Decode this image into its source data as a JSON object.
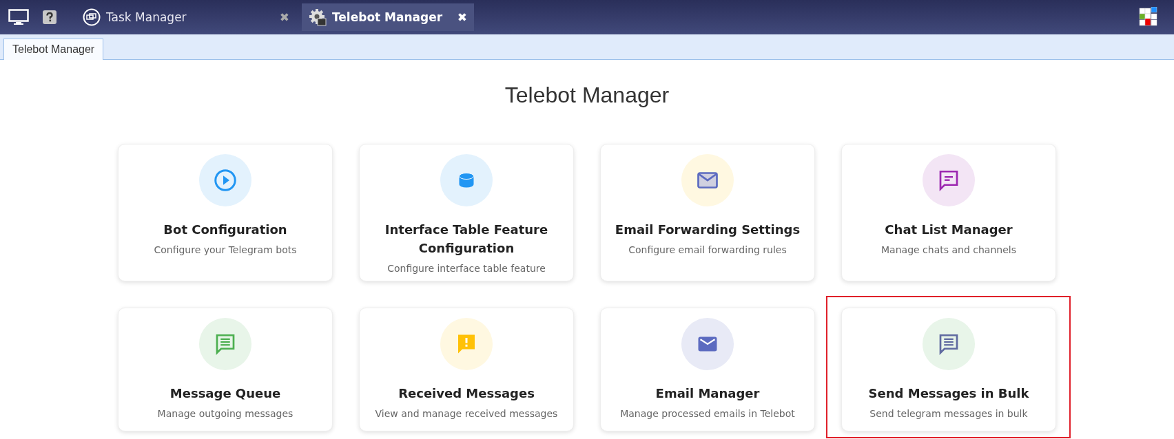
{
  "window_tabs": [
    {
      "kind": "task",
      "label": "Task Manager",
      "close": "✖",
      "selected": false
    },
    {
      "kind": "gear",
      "label": "Telebot Manager",
      "close": "✖",
      "selected": true
    }
  ],
  "sub_tabs": [
    {
      "label": "Telebot Manager",
      "selected": true
    }
  ],
  "page_title": "Telebot Manager",
  "cards": [
    {
      "icon": {
        "kind": "play",
        "color": "#2196f3"
      },
      "title": "Bot Configuration",
      "description": "Configure your Telegram bots",
      "color": "#e3f2fd",
      "highlighted": false
    },
    {
      "icon": {
        "kind": "database",
        "color": "#2196f3"
      },
      "title": "Interface Table Feature Configuration",
      "description": "Configure interface table feature",
      "color": "#e3f2fd",
      "highlighted": false
    },
    {
      "icon": {
        "kind": "mail-outline",
        "color": "#5c6bc0"
      },
      "title": "Email Forwarding Settings",
      "description": "Configure email forwarding rules",
      "color": "#fff8e1",
      "highlighted": false
    },
    {
      "icon": {
        "kind": "chat-outline",
        "color": "#9c27b0"
      },
      "title": "Chat List Manager",
      "description": "Manage chats and channels",
      "color": "#f3e5f5",
      "highlighted": false
    },
    {
      "icon": {
        "kind": "chat-lines",
        "color": "#4caf50"
      },
      "title": "Message Queue",
      "description": "Manage outgoing messages",
      "color": "#e8f5e9",
      "highlighted": false
    },
    {
      "icon": {
        "kind": "chat-alert",
        "color": "#ffc107"
      },
      "title": "Received Messages",
      "description": "View and manage received messages",
      "color": "#fff8e1",
      "highlighted": false
    },
    {
      "icon": {
        "kind": "mail",
        "color": "#5c6bc0"
      },
      "title": "Email Manager",
      "description": "Manage processed emails in Telebot",
      "color": "#e8eaf6",
      "highlighted": false
    },
    {
      "icon": {
        "kind": "chat-lines",
        "color": "#5f6aa0"
      },
      "title": "Send Messages in Bulk",
      "description": "Send telegram messages in bulk",
      "color": "#e8f5e9",
      "highlighted": true
    }
  ]
}
